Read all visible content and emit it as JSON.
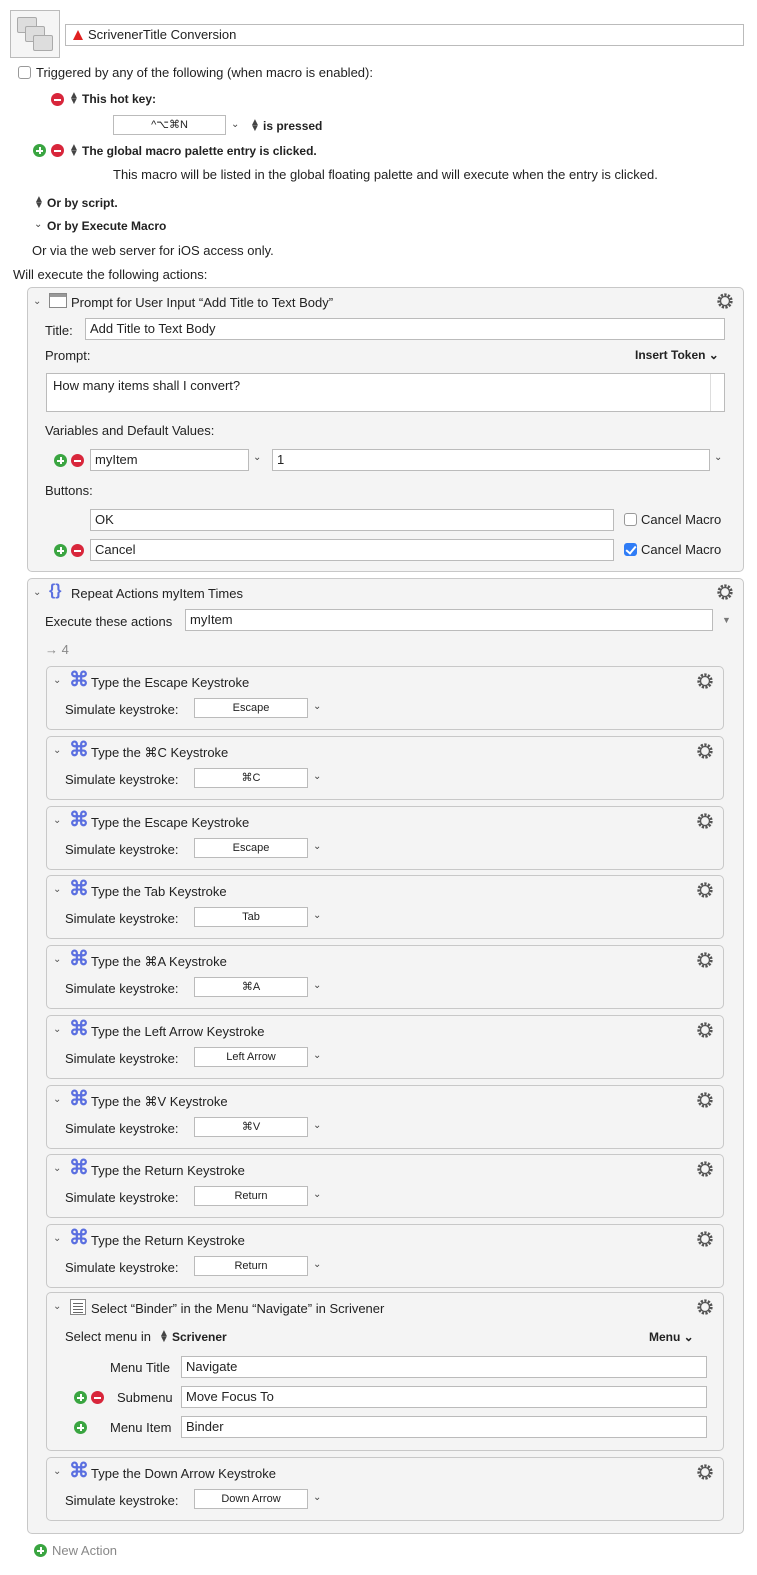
{
  "macro": {
    "name": "ScrivenerTitle Conversion"
  },
  "triggers": {
    "header": "Triggered by any of the following (when macro is enabled):",
    "hotkey_label": "This hot key:",
    "hotkey_value": "^⌥⌘N",
    "hotkey_state": "is pressed",
    "palette_label": "The global macro palette entry is clicked.",
    "palette_desc": "This macro will be listed in the global floating palette and will execute when the entry is clicked.",
    "script_label": "Or by script.",
    "execute_label": "Or by Execute Macro",
    "web_label": "Or via the web server for iOS access only."
  },
  "will_execute": "Will execute the following actions:",
  "prompt_action": {
    "title": "Prompt for User Input “Add Title to Text Body”",
    "title_label": "Title:",
    "title_value": "Add Title to Text Body",
    "prompt_label": "Prompt:",
    "insert_token": "Insert Token",
    "prompt_value": "How many items shall I convert?",
    "vars_label": "Variables and Default Values:",
    "var_name": "myItem",
    "var_default": "1",
    "buttons_label": "Buttons:",
    "button1": "OK",
    "button1_cancel": "Cancel Macro",
    "button1_checked": false,
    "button2": "Cancel",
    "button2_cancel": "Cancel Macro",
    "button2_checked": true
  },
  "repeat_action": {
    "title": "Repeat Actions myItem Times",
    "execute_label": "Execute these actions",
    "execute_value": "myItem",
    "arrow_value": "→ 4"
  },
  "keystroke_label": "Simulate keystroke:",
  "keystrokes": [
    {
      "title": "Type the Escape Keystroke",
      "key": "Escape"
    },
    {
      "title": "Type the ⌘C Keystroke",
      "key": "⌘C"
    },
    {
      "title": "Type the Escape Keystroke",
      "key": "Escape"
    },
    {
      "title": "Type the Tab Keystroke",
      "key": "Tab"
    },
    {
      "title": "Type the ⌘A Keystroke",
      "key": "⌘A"
    },
    {
      "title": "Type the Left Arrow Keystroke",
      "key": "Left Arrow"
    },
    {
      "title": "Type the ⌘V Keystroke",
      "key": "⌘V"
    },
    {
      "title": "Type the Return Keystroke",
      "key": "Return"
    },
    {
      "title": "Type the Return Keystroke",
      "key": "Return"
    }
  ],
  "menu_action": {
    "title": "Select “Binder” in the Menu “Navigate” in Scrivener",
    "select_label": "Select menu in",
    "app": "Scrivener",
    "menu_dropdown": "Menu",
    "menu_title_label": "Menu Title",
    "menu_title_value": "Navigate",
    "submenu_label": "Submenu",
    "submenu_value": "Move Focus To",
    "menu_item_label": "Menu Item",
    "menu_item_value": "Binder"
  },
  "last_keystroke": {
    "title": "Type the Down Arrow Keystroke",
    "key": "Down Arrow"
  },
  "new_action": "New Action"
}
